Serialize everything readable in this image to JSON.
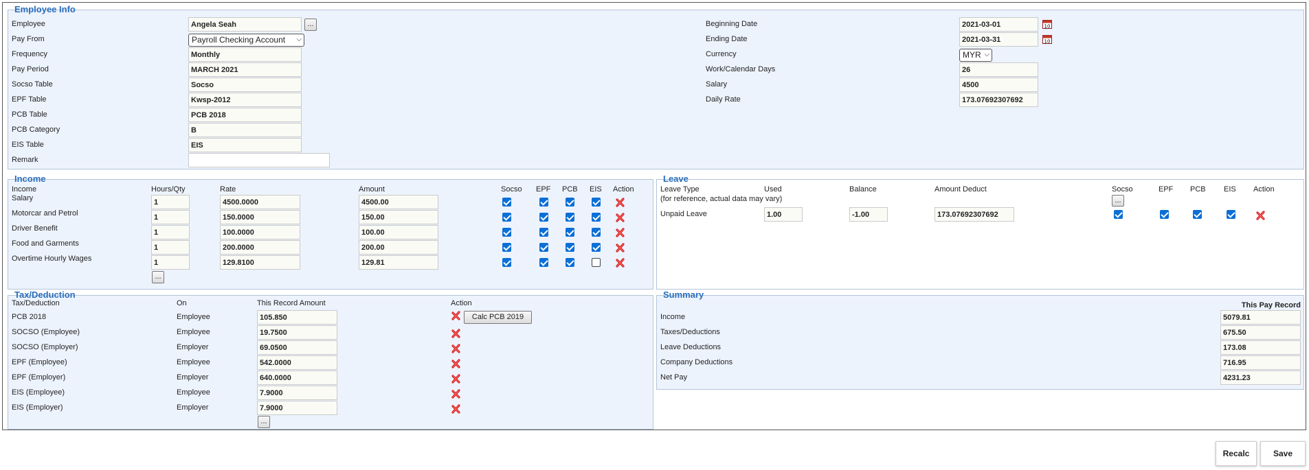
{
  "employee_info": {
    "legend": "Employee Info",
    "employee_label": "Employee",
    "employee_value": "Angela Seah",
    "pay_from_label": "Pay From",
    "pay_from_value": "Payroll Checking Account",
    "frequency_label": "Frequency",
    "frequency_value": "Monthly",
    "pay_period_label": "Pay Period",
    "pay_period_value": "MARCH 2021",
    "socso_table_label": "Socso Table",
    "socso_table_value": "Socso",
    "epf_table_label": "EPF Table",
    "epf_table_value": "Kwsp-2012",
    "pcb_table_label": "PCB Table",
    "pcb_table_value": "PCB 2018",
    "pcb_category_label": "PCB Category",
    "pcb_category_value": "B",
    "eis_table_label": "EIS Table",
    "eis_table_value": "EIS",
    "remark_label": "Remark",
    "remark_value": "",
    "beginning_date_label": "Beginning Date",
    "beginning_date_value": "2021-03-01",
    "ending_date_label": "Ending Date",
    "ending_date_value": "2021-03-31",
    "currency_label": "Currency",
    "currency_value": "MYR",
    "work_days_label": "Work/Calendar Days",
    "work_days_value": "26",
    "salary_label": "Salary",
    "salary_value": "4500",
    "daily_rate_label": "Daily Rate",
    "daily_rate_value": "173.07692307692",
    "more_button": "..."
  },
  "income": {
    "legend": "Income",
    "headers": {
      "income": "Income",
      "hours": "Hours/Qty",
      "rate": "Rate",
      "amount": "Amount",
      "socso": "Socso",
      "epf": "EPF",
      "pcb": "PCB",
      "eis": "EIS",
      "action": "Action"
    },
    "rows": [
      {
        "name": "Salary",
        "hours": "1",
        "rate": "4500.0000",
        "amount": "4500.00",
        "socso": true,
        "epf": true,
        "pcb": true,
        "eis": true
      },
      {
        "name": "Motorcar and Petrol",
        "hours": "1",
        "rate": "150.0000",
        "amount": "150.00",
        "socso": true,
        "epf": true,
        "pcb": true,
        "eis": true
      },
      {
        "name": "Driver Benefit",
        "hours": "1",
        "rate": "100.0000",
        "amount": "100.00",
        "socso": true,
        "epf": true,
        "pcb": true,
        "eis": true
      },
      {
        "name": "Food and Garments",
        "hours": "1",
        "rate": "200.0000",
        "amount": "200.00",
        "socso": true,
        "epf": true,
        "pcb": true,
        "eis": true
      },
      {
        "name": "Overtime Hourly Wages",
        "hours": "1",
        "rate": "129.8100",
        "amount": "129.81",
        "socso": true,
        "epf": true,
        "pcb": true,
        "eis": false
      }
    ],
    "add_button": "..."
  },
  "leave": {
    "legend": "Leave",
    "headers": {
      "type": "Leave Type",
      "note": "(for reference, actual data may vary)",
      "used": "Used",
      "balance": "Balance",
      "amount": "Amount Deduct",
      "socso": "Socso",
      "epf": "EPF",
      "pcb": "PCB",
      "eis": "EIS",
      "action": "Action"
    },
    "socso_button": "...",
    "rows": [
      {
        "type": "Unpaid Leave",
        "used": "1.00",
        "balance": "-1.00",
        "amount": "173.07692307692",
        "socso": true,
        "epf": true,
        "pcb": true,
        "eis": true
      }
    ]
  },
  "tax": {
    "legend": "Tax/Deduction",
    "headers": {
      "name": "Tax/Deduction",
      "on": "On",
      "amount": "This Record Amount",
      "action": "Action"
    },
    "calc_button": "Calc PCB 2019",
    "rows": [
      {
        "name": "PCB 2018",
        "on": "Employee",
        "amount": "105.850"
      },
      {
        "name": "SOCSO (Employee)",
        "on": "Employee",
        "amount": "19.7500"
      },
      {
        "name": "SOCSO (Employer)",
        "on": "Employer",
        "amount": "69.0500"
      },
      {
        "name": "EPF (Employee)",
        "on": "Employee",
        "amount": "542.0000"
      },
      {
        "name": "EPF (Employer)",
        "on": "Employer",
        "amount": "640.0000"
      },
      {
        "name": "EIS (Employee)",
        "on": "Employee",
        "amount": "7.9000"
      },
      {
        "name": "EIS (Employer)",
        "on": "Employer",
        "amount": "7.9000"
      }
    ],
    "add_button": "..."
  },
  "summary": {
    "legend": "Summary",
    "header": "This Pay Record",
    "rows": [
      {
        "label": "Income",
        "value": "5079.81"
      },
      {
        "label": "Taxes/Deductions",
        "value": "675.50"
      },
      {
        "label": "Leave Deductions",
        "value": "173.08"
      },
      {
        "label": "Company Deductions",
        "value": "716.95"
      },
      {
        "label": "Net Pay",
        "value": "4231.23"
      }
    ]
  },
  "footer": {
    "recalc": "Recalc",
    "save": "Save"
  },
  "icons": {
    "delete": "delete-x-icon",
    "calendar": "calendar-icon"
  },
  "colors": {
    "legend": "#2a6ebb",
    "panel": "#edf3fd",
    "checkbox": "#0b6fd6",
    "delete": "#e02020"
  }
}
